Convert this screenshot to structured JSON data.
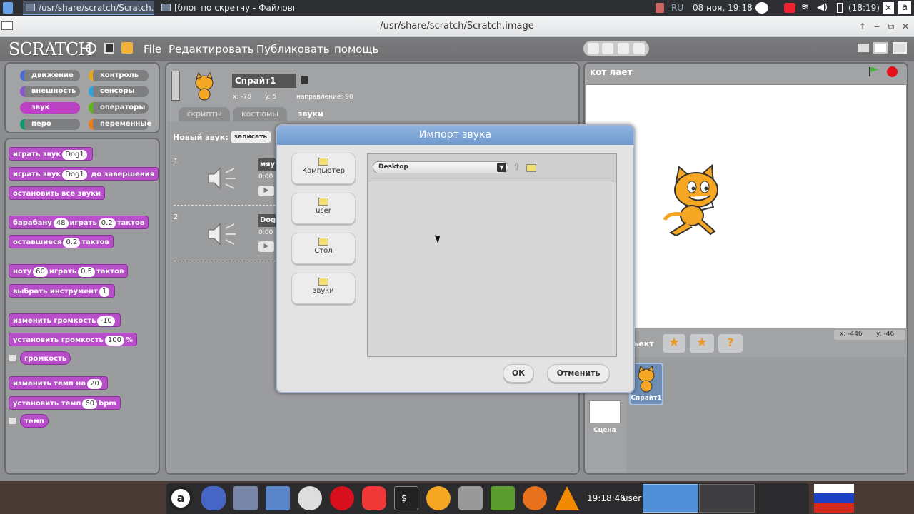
{
  "top_panel": {
    "tasks": [
      {
        "label": "/usr/share/scratch/Scratch.i..."
      },
      {
        "label": "[блог по скретчу - Файловы..."
      }
    ],
    "lang": "RU",
    "datetime": "08 ноя, 19:18",
    "battery": "(18:19)",
    "kbd": "a"
  },
  "window": {
    "title": "/usr/share/scratch/Scratch.image"
  },
  "scratch": {
    "logo": "SCRATCH",
    "menu": [
      "File",
      "Редактировать",
      "Публиковать",
      "помощь"
    ],
    "categories": [
      {
        "label": "движение",
        "color": "#4a6cd4"
      },
      {
        "label": "контроль",
        "color": "#e6a822"
      },
      {
        "label": "внешность",
        "color": "#8a55d7"
      },
      {
        "label": "сенсоры",
        "color": "#2ca5e2"
      },
      {
        "label": "звук",
        "color": "#bb42c3"
      },
      {
        "label": "операторы",
        "color": "#5cb712"
      },
      {
        "label": "перо",
        "color": "#0e9a6c"
      },
      {
        "label": "переменные",
        "color": "#ee7d16"
      }
    ],
    "blocks": {
      "play_sound": "играть звук",
      "play_sound_val": "Dog1",
      "play_until": "играть звук",
      "play_until_val": "Dog1",
      "play_until_tail": "до завершения",
      "stop_all": "остановить все звуки",
      "drum": "барабану",
      "drum_val": "48",
      "drum_play": "играть",
      "drum_beats": "0.2",
      "drum_tail": "тактов",
      "rest": "оставшиеся",
      "rest_val": "0.2",
      "rest_tail": "тактов",
      "note": "ноту",
      "note_val": "60",
      "note_play": "играть",
      "note_beats": "0.5",
      "note_tail": "тактов",
      "instrument": "выбрать инструмент",
      "instrument_val": "1",
      "change_vol": "изменить громкость",
      "change_vol_val": "-10",
      "set_vol": "установить громкость",
      "set_vol_val": "100",
      "set_vol_pct": "%",
      "volume": "громкость",
      "change_tempo": "изменить темп на",
      "change_tempo_val": "20",
      "set_tempo": "установить темп",
      "set_tempo_val": "60",
      "set_tempo_unit": "bpm",
      "tempo": "темп"
    },
    "sprite": {
      "name": "Спрайт1",
      "x_label": "x: -76",
      "y_label": "y: 5",
      "direction": "направление: 90"
    },
    "tabs": [
      "скрипты",
      "костюмы",
      "звуки"
    ],
    "new_sound_label": "Новый звук:",
    "record_btn": "записать",
    "sounds": [
      {
        "num": "1",
        "name": "мяу",
        "time": "0:00"
      },
      {
        "num": "2",
        "name": "Dog",
        "time": "0:00"
      }
    ],
    "stage_title": "кот лает",
    "stage_coords": {
      "x": "x: -446",
      "y": "y: -46"
    },
    "new_object": "ъект",
    "sprite_thumb": "Спрайт1",
    "stage_label": "Сцена"
  },
  "dialog": {
    "title": "Импорт звука",
    "places": [
      "Компьютер",
      "user",
      "Стол",
      "звуки"
    ],
    "path": "Desktop",
    "ok": "ОК",
    "cancel": "Отменить"
  },
  "taskbar": {
    "time": "19:18:46",
    "user": "user"
  }
}
